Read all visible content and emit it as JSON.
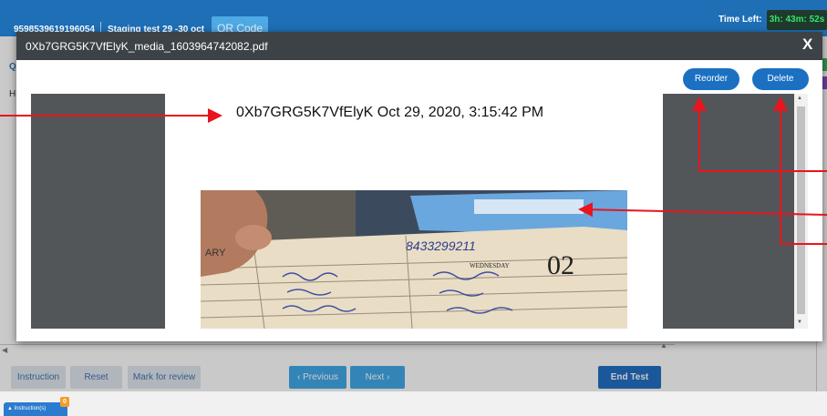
{
  "topbar": {
    "phone": "9598539619196054",
    "test_name": "Staging test 29 -30 oct",
    "qr_label": "QR Code",
    "time_label": "Time Left:",
    "time_value": "3h: 43m: 52s"
  },
  "background": {
    "left_q": "Q",
    "left_h": "H"
  },
  "modal": {
    "file_name": "0Xb7GRG5K7VfElyK_media_1603964742082.pdf",
    "close_label": "X",
    "reorder_label": "Reorder",
    "delete_label": "Delete",
    "page_header": "0Xb7GRG5K7VfElyK Oct 29, 2020, 3:15:42 PM"
  },
  "footer": {
    "instruction": "Instruction",
    "reset": "Reset",
    "mark_review": "Mark for review",
    "previous": "‹ Previous",
    "next": "Next ›",
    "end_test": "End Test"
  },
  "bottombar": {
    "instructions_tab": "Instruction(s)",
    "badge_count": "0"
  },
  "annotation_color": "#e8141e",
  "photo_handwriting": {
    "date_day": "02",
    "weekday": "WEDNESDAY",
    "phone_written": "8433299211",
    "month_fragment": "ARY"
  }
}
